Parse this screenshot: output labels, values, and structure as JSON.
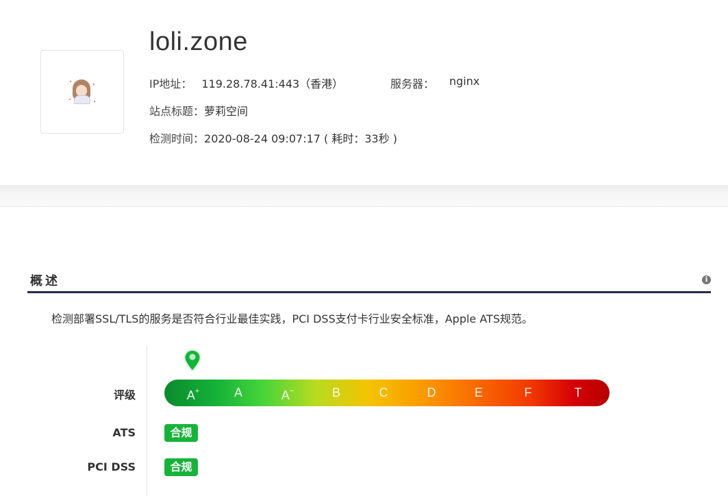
{
  "site": {
    "domain": "loli.zone",
    "ip_label": "IP地址：",
    "ip_value": "119.28.78.41:443（香港）",
    "server_label": "服务器：",
    "server_value": "nginx",
    "title_label": "站点标题：",
    "title_value": "萝莉空间",
    "time_label": "检测时间：",
    "time_value": "2020-08-24 09:07:17 ( 耗时：33秒 )"
  },
  "overview": {
    "title": "概述",
    "description": "检测部署SSL/TLS的服务是否符合行业最佳实践，PCI DSS支付卡行业安全标准，Apple ATS规范。",
    "info_icon": "info-icon"
  },
  "rating": {
    "label": "评级",
    "grades": [
      {
        "base": "A",
        "mod": "+"
      },
      {
        "base": "A",
        "mod": ""
      },
      {
        "base": "A",
        "mod": "−"
      },
      {
        "base": "B",
        "mod": ""
      },
      {
        "base": "C",
        "mod": ""
      },
      {
        "base": "D",
        "mod": ""
      },
      {
        "base": "E",
        "mod": ""
      },
      {
        "base": "F",
        "mod": ""
      },
      {
        "base": "T",
        "mod": ""
      }
    ],
    "current_grade": "A+",
    "pin_color": "#16b33a"
  },
  "compliance": {
    "ats_label": "ATS",
    "ats_status": "合规",
    "pci_label": "PCI DSS",
    "pci_status": "合规",
    "status_color": "#16b33a"
  }
}
